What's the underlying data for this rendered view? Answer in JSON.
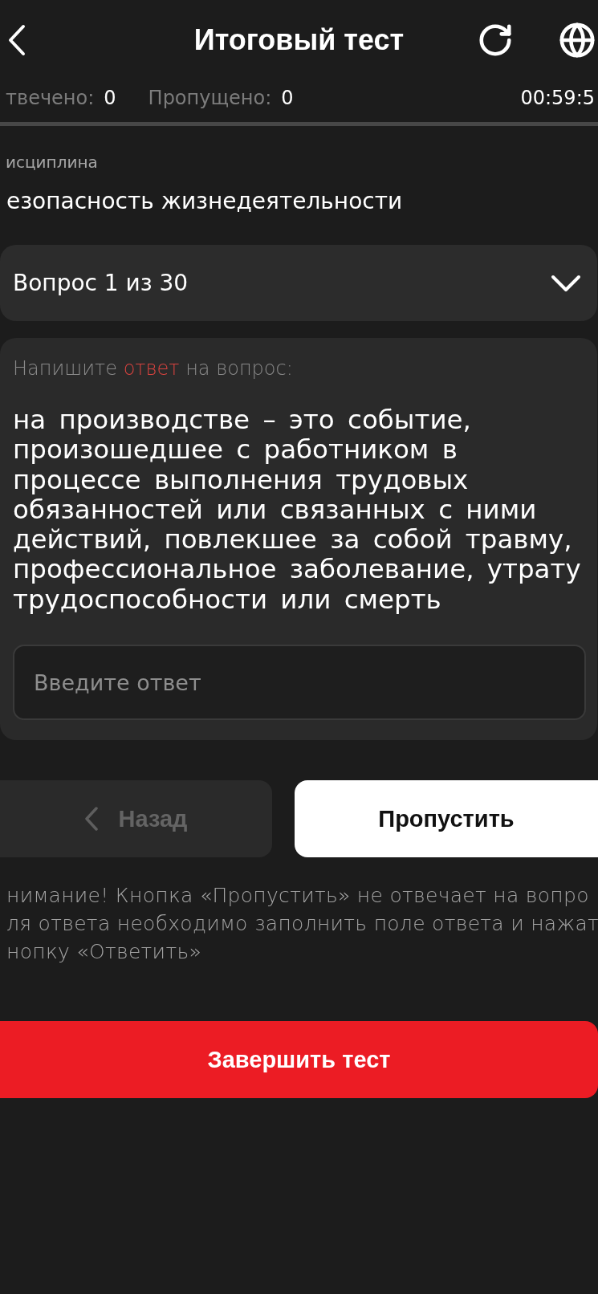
{
  "header": {
    "title": "Итоговый тест"
  },
  "stats": {
    "answered_label": "твечено:",
    "answered": "0",
    "skipped_label": "Пропущено:",
    "skipped": "0",
    "timer": "00:59:5"
  },
  "discipline": {
    "label": "исциплина",
    "value": "езопасность жизнедеятельности"
  },
  "question_selector": {
    "label": "Вопрос 1 из 30",
    "expanded": false
  },
  "question": {
    "prompt": [
      {
        "text": "Напишите",
        "highlight": false
      },
      {
        "text": "ответ",
        "highlight": true
      },
      {
        "text": "на вопрос:",
        "highlight": false
      }
    ],
    "text": "на производстве – это событие, произошедшее с работником в процессе выполнения трудовых обязанностей или связанных с ними действий, повлекшее за собой травму, профессиональное заболевание, утрату трудоспособности или смерть",
    "answer": {
      "placeholder": "Введите ответ"
    }
  },
  "nav_buttons": [
    {
      "kind": "back",
      "label": "Назад",
      "disabled": true
    },
    {
      "kind": "skip",
      "label": "Пропустить",
      "disabled": false
    }
  ],
  "warning_lines": [
    "нимание! Кнопка «Пропустить» не отвечает на вопро",
    "ля ответа необходимо заполнить поле ответа и нажат",
    "нопку «Ответить»"
  ],
  "finish_button": {
    "label": "Завершить тест"
  }
}
